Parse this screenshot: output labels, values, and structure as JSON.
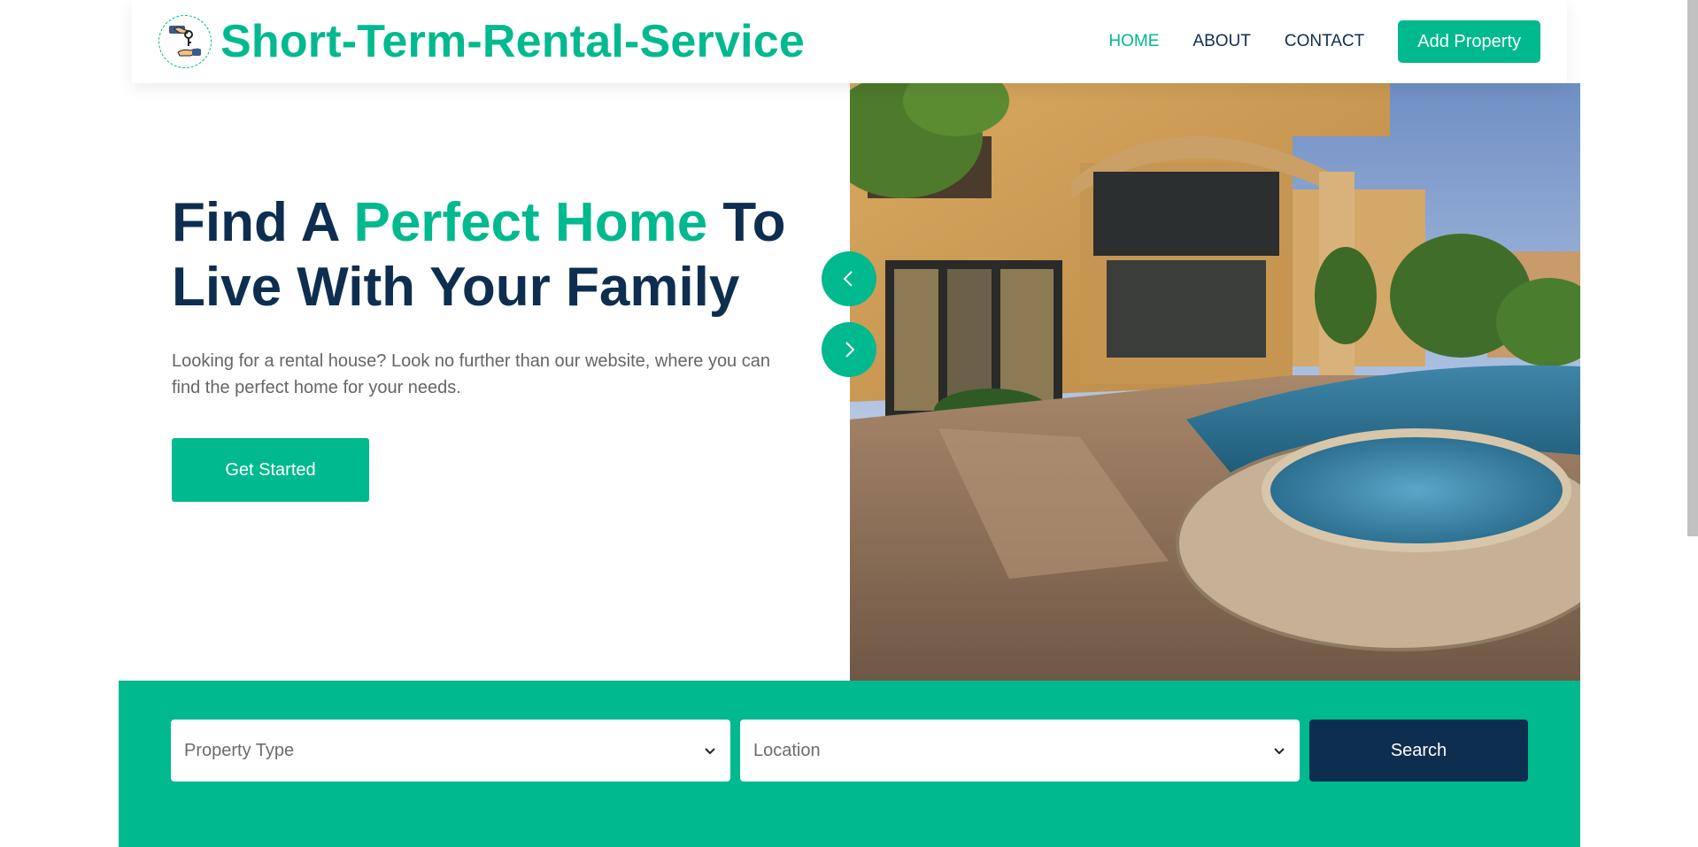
{
  "brand": {
    "name": "Short-Term-Rental-Service",
    "logo_icon": "key-handover-icon"
  },
  "nav": {
    "items": [
      {
        "label": "HOME",
        "active": true
      },
      {
        "label": "ABOUT",
        "active": false
      },
      {
        "label": "CONTACT",
        "active": false
      }
    ],
    "add_property_label": "Add Property"
  },
  "hero": {
    "title_part1": "Find A ",
    "title_accent": "Perfect Home",
    "title_part2": " To Live With Your Family",
    "description": "Looking for a rental house? Look no further than our website, where you can find the perfect home for your needs.",
    "cta_label": "Get Started",
    "image_alt": "Luxury house with pool at sunset",
    "prev_icon": "chevron-left-icon",
    "next_icon": "chevron-right-icon"
  },
  "search": {
    "property_type_placeholder": "Property Type",
    "location_placeholder": "Location",
    "button_label": "Search"
  },
  "colors": {
    "accent": "#00b98e",
    "dark": "#0e2e50",
    "text_muted": "#666565"
  }
}
